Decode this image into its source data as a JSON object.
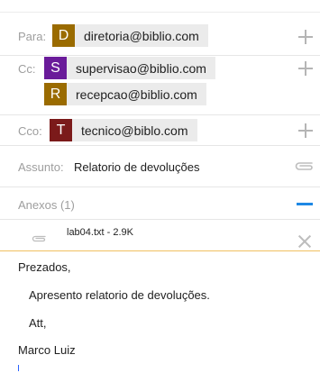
{
  "fields": {
    "to": {
      "label": "Para:",
      "recipients": [
        {
          "initial": "D",
          "email": "diretoria@biblio.com",
          "color": "#9a6b00"
        }
      ]
    },
    "cc": {
      "label": "Cc:",
      "recipients": [
        {
          "initial": "S",
          "email": "supervisao@biblio.com",
          "color": "#6a1b9a"
        },
        {
          "initial": "R",
          "email": "recepcao@biblio.com",
          "color": "#9a6b00"
        }
      ]
    },
    "bcc": {
      "label": "Cco:",
      "recipients": [
        {
          "initial": "T",
          "email": "tecnico@biblo.com",
          "color": "#7b1a1a"
        }
      ]
    },
    "subject": {
      "label": "Assunto:",
      "value": "Relatorio de devoluções"
    }
  },
  "attachments": {
    "header": "Anexos (1)",
    "items": [
      {
        "name": "lab04.txt - 2.9K"
      }
    ]
  },
  "body": {
    "lines": [
      "Prezados,",
      "Apresento relatorio de devoluções.",
      "Att,",
      "Marco Luiz"
    ]
  },
  "colors": {
    "accent": "#1e88e5",
    "attachment_divider": "#f0c060"
  },
  "icons": {
    "add": "plus-icon",
    "attach": "paperclip-icon",
    "collapse": "minus-icon",
    "remove": "close-icon"
  }
}
